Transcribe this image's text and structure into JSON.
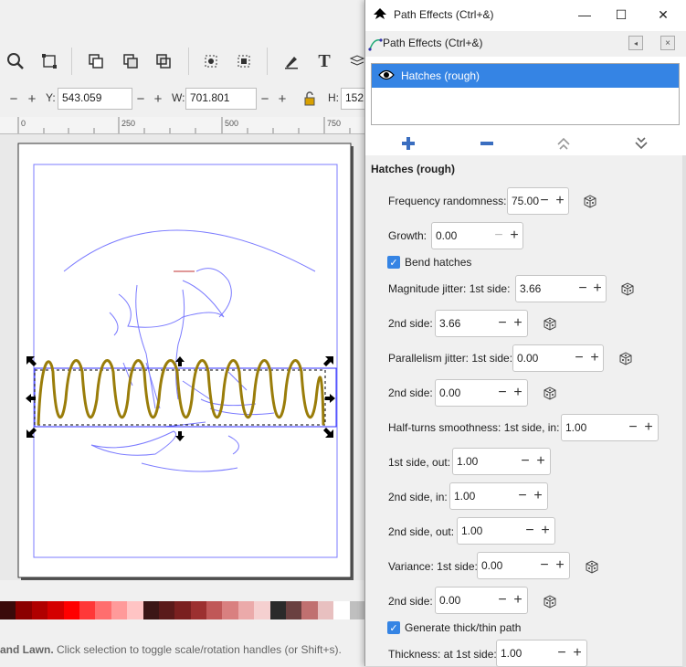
{
  "window": {
    "title": "Path Effects (Ctrl+&)",
    "minimize": "—",
    "maximize": "☐",
    "close": "✕"
  },
  "dock": {
    "title": "Path Effects (Ctrl+&)"
  },
  "effects_list": {
    "items": [
      {
        "label": "Hatches (rough)",
        "visible": true,
        "selected": true
      }
    ]
  },
  "list_actions": {
    "add": "+",
    "remove": "−",
    "move_up": "up",
    "move_down": "down"
  },
  "effect": {
    "name": "Hatches (rough)",
    "params": {
      "frequency_randomness": {
        "label": "Frequency randomness:",
        "value": "75.00"
      },
      "growth": {
        "label": "Growth:",
        "value": "0.00"
      },
      "bend_hatches": {
        "label": "Bend hatches",
        "checked": true
      },
      "magnitude_jitter_1st": {
        "label": "Magnitude jitter: 1st side:",
        "value": "3.66"
      },
      "magnitude_jitter_2nd": {
        "label": "2nd side:",
        "value": "3.66"
      },
      "parallelism_jitter_1st": {
        "label": "Parallelism jitter: 1st side:",
        "value": "0.00"
      },
      "parallelism_jitter_2nd": {
        "label": "2nd side:",
        "value": "0.00"
      },
      "half_turns_1st_in": {
        "label": "Half-turns smoothness: 1st side, in:",
        "value": "1.00"
      },
      "half_turns_1st_out": {
        "label": "1st side, out:",
        "value": "1.00"
      },
      "half_turns_2nd_in": {
        "label": "2nd side, in:",
        "value": "1.00"
      },
      "half_turns_2nd_out": {
        "label": "2nd side, out:",
        "value": "1.00"
      },
      "variance_1st": {
        "label": "Variance: 1st side:",
        "value": "0.00"
      },
      "variance_2nd": {
        "label": "2nd side:",
        "value": "0.00"
      },
      "generate_thick_thin": {
        "label": "Generate thick/thin path",
        "checked": true
      },
      "thickness_1st": {
        "label": "Thickness: at 1st side:",
        "value": "1.00"
      }
    }
  },
  "toolbar": {
    "y_label": "Y:",
    "y_value": "543.059",
    "w_label": "W:",
    "w_value": "701.801",
    "h_label": "H:",
    "h_value": "152"
  },
  "ruler": {
    "ticks": [
      "0",
      "250",
      "500",
      "750"
    ]
  },
  "palette": [
    "#3a0a0a",
    "#8b0000",
    "#b00000",
    "#d40000",
    "#ff0000",
    "#ff3838",
    "#ff6e6e",
    "#ff9a9a",
    "#ffc4c4",
    "#3b1616",
    "#5a1a1a",
    "#7a2020",
    "#9c3030",
    "#c05858",
    "#d98080",
    "#ebaaaa",
    "#f5d0d0",
    "#2a2a2a",
    "#6a4040",
    "#c07070",
    "#e8c0c0",
    "#ffffff",
    "#bfbfbf"
  ],
  "status": {
    "bold": "and Lawn.",
    "text": " Click selection to toggle scale/rotation handles (or Shift+s)."
  },
  "colors": {
    "accent": "#3584e4",
    "hatch_path": "#9a7d0a",
    "guide": "#7b7bff"
  }
}
